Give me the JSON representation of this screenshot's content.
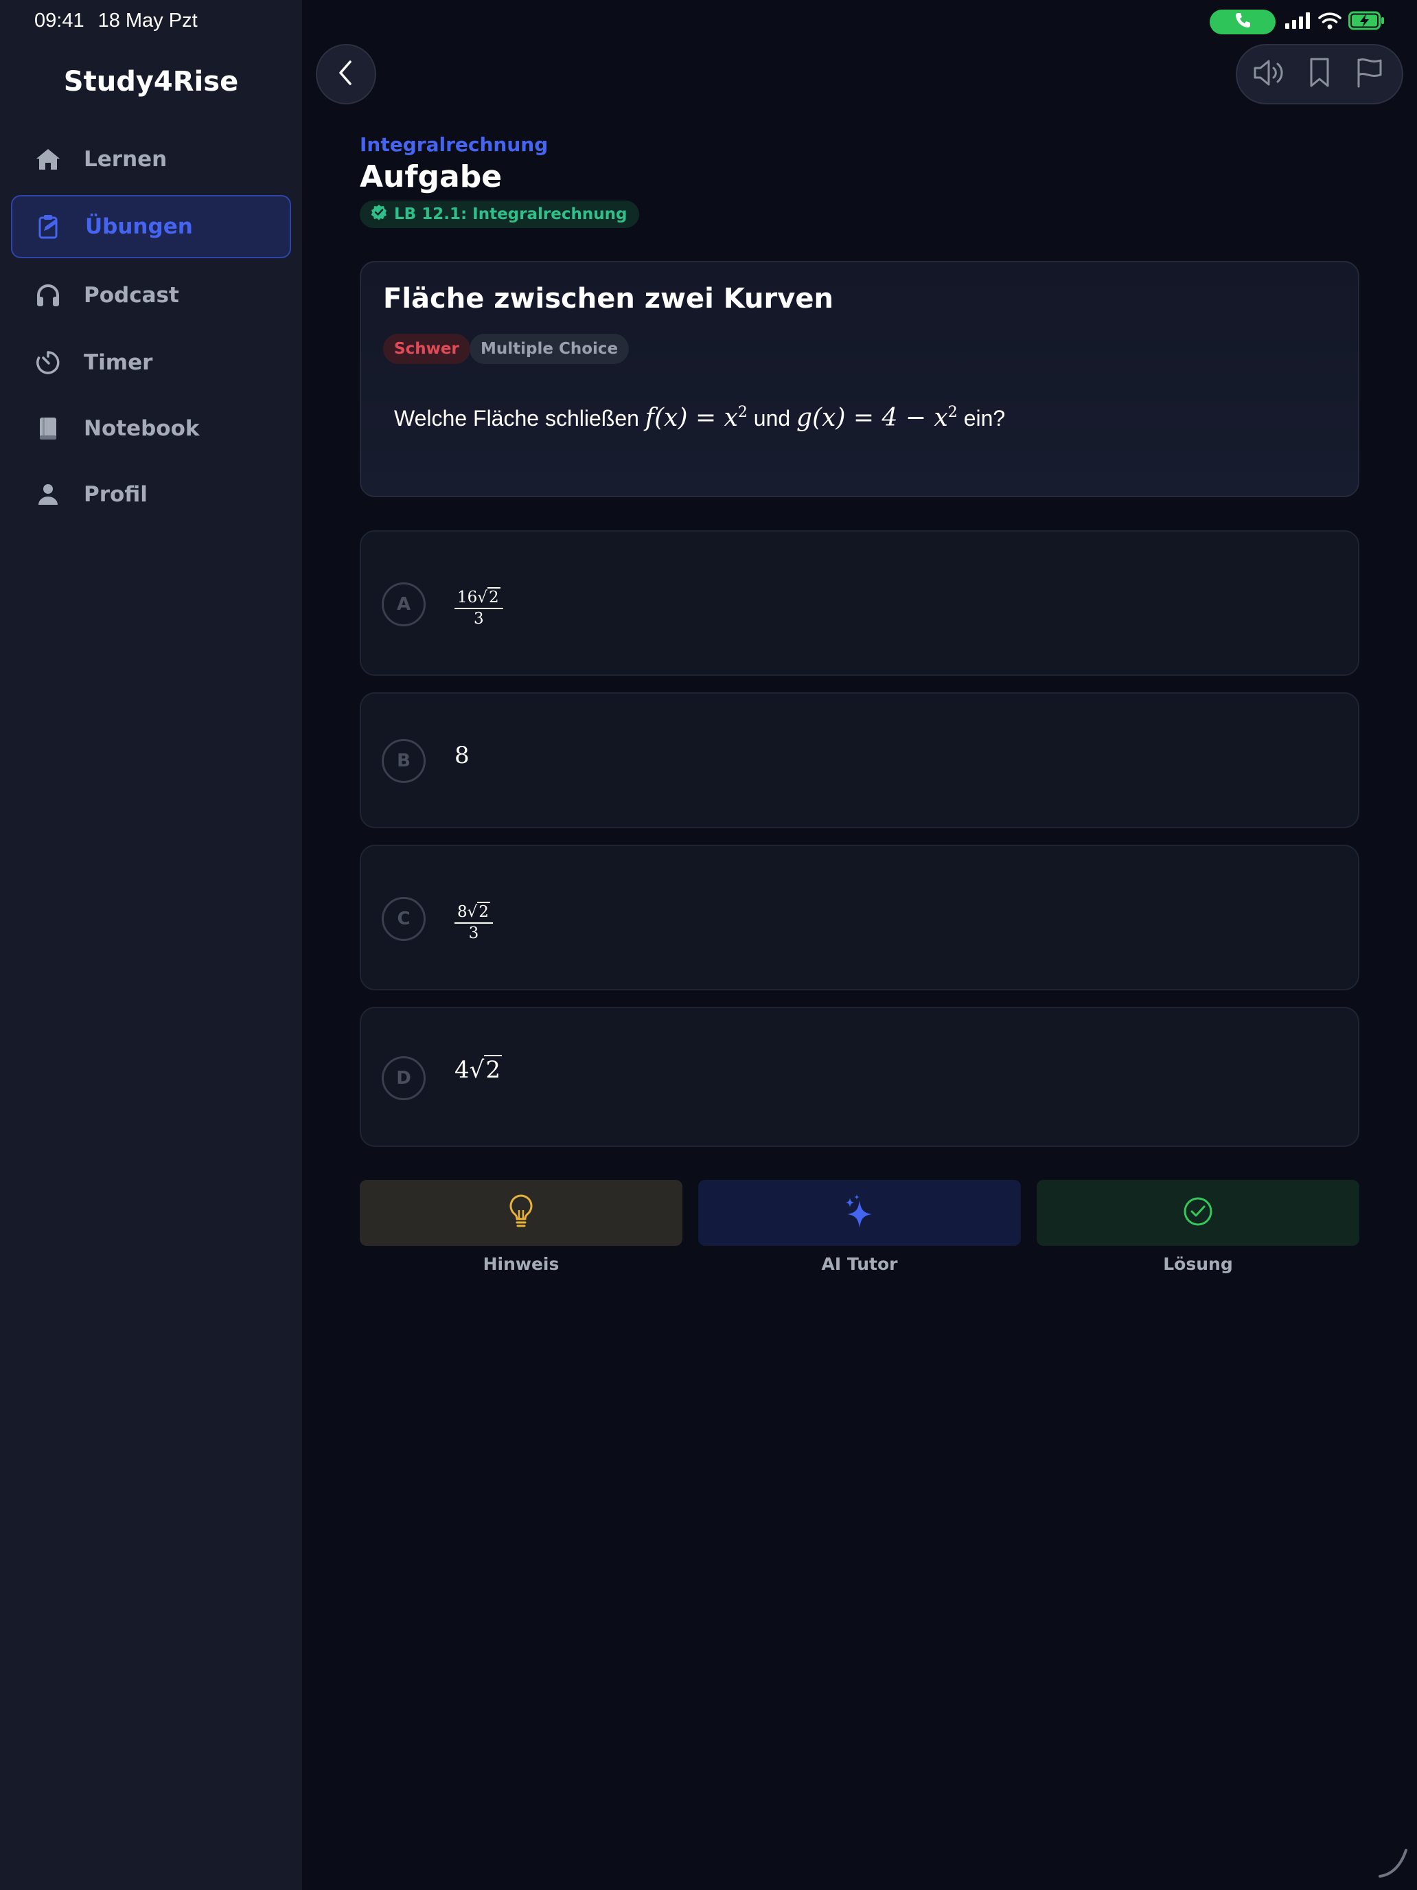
{
  "status_bar": {
    "time": "09:41",
    "date": "18 May Pzt"
  },
  "sidebar": {
    "brand": "Study4Rise",
    "items": [
      {
        "label": "Lernen",
        "icon": "home-icon",
        "active": false
      },
      {
        "label": "Übungen",
        "icon": "clipboard-edit-icon",
        "active": true
      },
      {
        "label": "Podcast",
        "icon": "headphones-icon",
        "active": false
      },
      {
        "label": "Timer",
        "icon": "timer-icon",
        "active": false
      },
      {
        "label": "Notebook",
        "icon": "notebook-icon",
        "active": false
      },
      {
        "label": "Profil",
        "icon": "user-icon",
        "active": false
      }
    ]
  },
  "header": {
    "category": "Integralrechnung",
    "title": "Aufgabe",
    "badge": "LB 12.1: Integralrechnung"
  },
  "question": {
    "title": "Fläche zwischen zwei Kurven",
    "difficulty": "Schwer",
    "type": "Multiple Choice",
    "text_prefix": "Welche Fläche schließen",
    "f_expr": "f(x) = x",
    "conj": "und",
    "g_expr": "g(x) = 4 − x",
    "text_suffix": "ein?",
    "exponent": "2"
  },
  "options": [
    {
      "letter": "A",
      "numerator_coef": "16",
      "radicand": "2",
      "denominator": "3"
    },
    {
      "letter": "B",
      "value": "8"
    },
    {
      "letter": "C",
      "numerator_coef": "8",
      "radicand": "2",
      "denominator": "3"
    },
    {
      "letter": "D",
      "coef": "4",
      "radicand": "2"
    }
  ],
  "actions": {
    "hint_label": "Hinweis",
    "tutor_label": "AI Tutor",
    "solution_label": "Lösung"
  },
  "colors": {
    "accent": "#4565f0",
    "badge_green": "#2fc08a",
    "difficulty_red": "#e04b57",
    "hint_yellow": "#e8b23a",
    "solution_green": "#34c759"
  }
}
